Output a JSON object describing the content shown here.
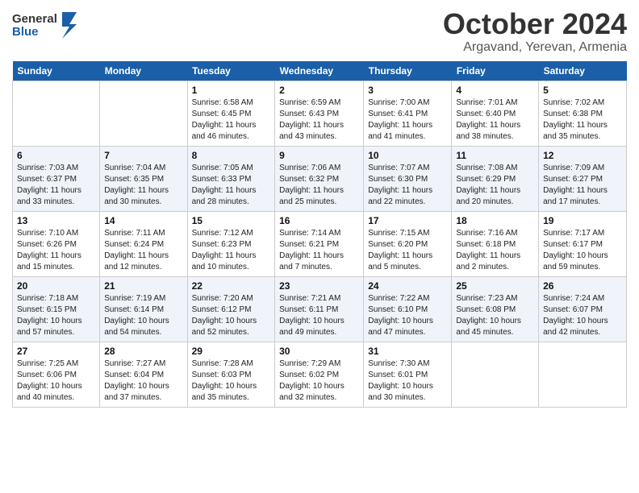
{
  "logo": {
    "line1": "General",
    "line2": "Blue"
  },
  "title": "October 2024",
  "location": "Argavand, Yerevan, Armenia",
  "days_of_week": [
    "Sunday",
    "Monday",
    "Tuesday",
    "Wednesday",
    "Thursday",
    "Friday",
    "Saturday"
  ],
  "weeks": [
    [
      {
        "day": "",
        "info": ""
      },
      {
        "day": "",
        "info": ""
      },
      {
        "day": "1",
        "info": "Sunrise: 6:58 AM\nSunset: 6:45 PM\nDaylight: 11 hours and 46 minutes."
      },
      {
        "day": "2",
        "info": "Sunrise: 6:59 AM\nSunset: 6:43 PM\nDaylight: 11 hours and 43 minutes."
      },
      {
        "day": "3",
        "info": "Sunrise: 7:00 AM\nSunset: 6:41 PM\nDaylight: 11 hours and 41 minutes."
      },
      {
        "day": "4",
        "info": "Sunrise: 7:01 AM\nSunset: 6:40 PM\nDaylight: 11 hours and 38 minutes."
      },
      {
        "day": "5",
        "info": "Sunrise: 7:02 AM\nSunset: 6:38 PM\nDaylight: 11 hours and 35 minutes."
      }
    ],
    [
      {
        "day": "6",
        "info": "Sunrise: 7:03 AM\nSunset: 6:37 PM\nDaylight: 11 hours and 33 minutes."
      },
      {
        "day": "7",
        "info": "Sunrise: 7:04 AM\nSunset: 6:35 PM\nDaylight: 11 hours and 30 minutes."
      },
      {
        "day": "8",
        "info": "Sunrise: 7:05 AM\nSunset: 6:33 PM\nDaylight: 11 hours and 28 minutes."
      },
      {
        "day": "9",
        "info": "Sunrise: 7:06 AM\nSunset: 6:32 PM\nDaylight: 11 hours and 25 minutes."
      },
      {
        "day": "10",
        "info": "Sunrise: 7:07 AM\nSunset: 6:30 PM\nDaylight: 11 hours and 22 minutes."
      },
      {
        "day": "11",
        "info": "Sunrise: 7:08 AM\nSunset: 6:29 PM\nDaylight: 11 hours and 20 minutes."
      },
      {
        "day": "12",
        "info": "Sunrise: 7:09 AM\nSunset: 6:27 PM\nDaylight: 11 hours and 17 minutes."
      }
    ],
    [
      {
        "day": "13",
        "info": "Sunrise: 7:10 AM\nSunset: 6:26 PM\nDaylight: 11 hours and 15 minutes."
      },
      {
        "day": "14",
        "info": "Sunrise: 7:11 AM\nSunset: 6:24 PM\nDaylight: 11 hours and 12 minutes."
      },
      {
        "day": "15",
        "info": "Sunrise: 7:12 AM\nSunset: 6:23 PM\nDaylight: 11 hours and 10 minutes."
      },
      {
        "day": "16",
        "info": "Sunrise: 7:14 AM\nSunset: 6:21 PM\nDaylight: 11 hours and 7 minutes."
      },
      {
        "day": "17",
        "info": "Sunrise: 7:15 AM\nSunset: 6:20 PM\nDaylight: 11 hours and 5 minutes."
      },
      {
        "day": "18",
        "info": "Sunrise: 7:16 AM\nSunset: 6:18 PM\nDaylight: 11 hours and 2 minutes."
      },
      {
        "day": "19",
        "info": "Sunrise: 7:17 AM\nSunset: 6:17 PM\nDaylight: 10 hours and 59 minutes."
      }
    ],
    [
      {
        "day": "20",
        "info": "Sunrise: 7:18 AM\nSunset: 6:15 PM\nDaylight: 10 hours and 57 minutes."
      },
      {
        "day": "21",
        "info": "Sunrise: 7:19 AM\nSunset: 6:14 PM\nDaylight: 10 hours and 54 minutes."
      },
      {
        "day": "22",
        "info": "Sunrise: 7:20 AM\nSunset: 6:12 PM\nDaylight: 10 hours and 52 minutes."
      },
      {
        "day": "23",
        "info": "Sunrise: 7:21 AM\nSunset: 6:11 PM\nDaylight: 10 hours and 49 minutes."
      },
      {
        "day": "24",
        "info": "Sunrise: 7:22 AM\nSunset: 6:10 PM\nDaylight: 10 hours and 47 minutes."
      },
      {
        "day": "25",
        "info": "Sunrise: 7:23 AM\nSunset: 6:08 PM\nDaylight: 10 hours and 45 minutes."
      },
      {
        "day": "26",
        "info": "Sunrise: 7:24 AM\nSunset: 6:07 PM\nDaylight: 10 hours and 42 minutes."
      }
    ],
    [
      {
        "day": "27",
        "info": "Sunrise: 7:25 AM\nSunset: 6:06 PM\nDaylight: 10 hours and 40 minutes."
      },
      {
        "day": "28",
        "info": "Sunrise: 7:27 AM\nSunset: 6:04 PM\nDaylight: 10 hours and 37 minutes."
      },
      {
        "day": "29",
        "info": "Sunrise: 7:28 AM\nSunset: 6:03 PM\nDaylight: 10 hours and 35 minutes."
      },
      {
        "day": "30",
        "info": "Sunrise: 7:29 AM\nSunset: 6:02 PM\nDaylight: 10 hours and 32 minutes."
      },
      {
        "day": "31",
        "info": "Sunrise: 7:30 AM\nSunset: 6:01 PM\nDaylight: 10 hours and 30 minutes."
      },
      {
        "day": "",
        "info": ""
      },
      {
        "day": "",
        "info": ""
      }
    ]
  ]
}
